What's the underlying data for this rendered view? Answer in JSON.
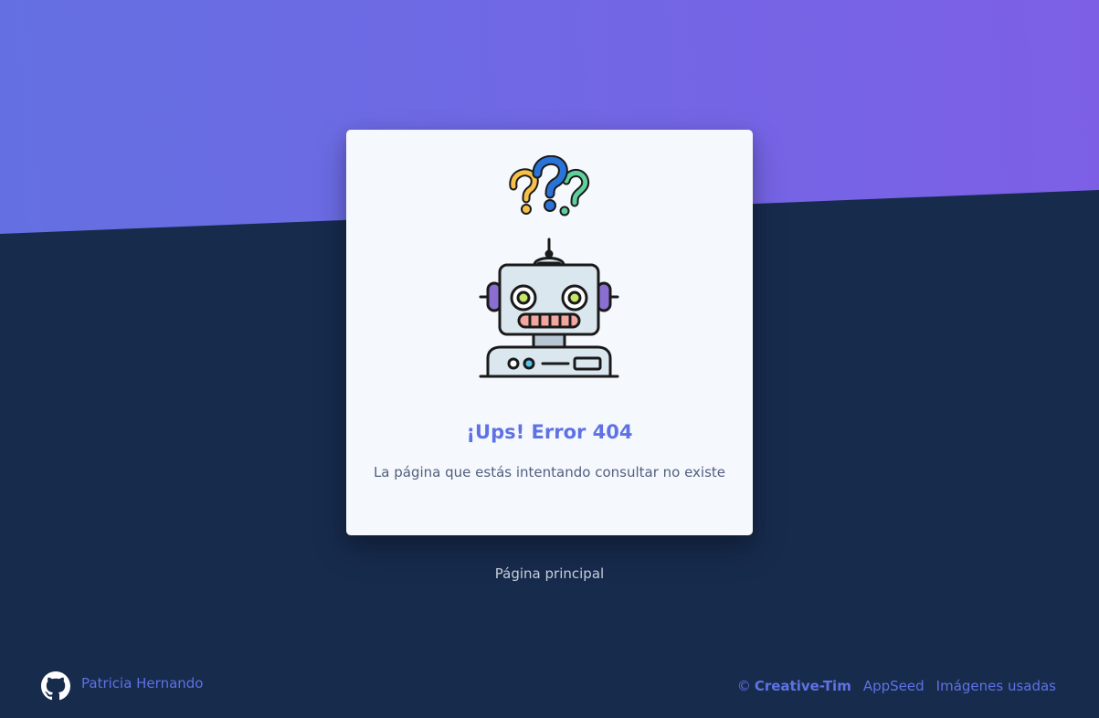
{
  "card": {
    "title": "¡Ups! Error 404",
    "message": "La página que estás intentando consultar no existe",
    "illustration_icon": "robot-with-question-marks"
  },
  "home_link": "Página principal",
  "footer": {
    "author_icon": "github-icon",
    "author": "Patricia Hernando",
    "copyright_symbol": "©",
    "copyright_brand": "Creative-Tim",
    "links": [
      "AppSeed",
      "Imágenes usadas"
    ]
  },
  "colors": {
    "accent": "#5e72e4",
    "background": "#172b4d",
    "gradient_start": "#6470e2",
    "gradient_end": "#7d5fe6",
    "card": "#f5f8fc"
  }
}
